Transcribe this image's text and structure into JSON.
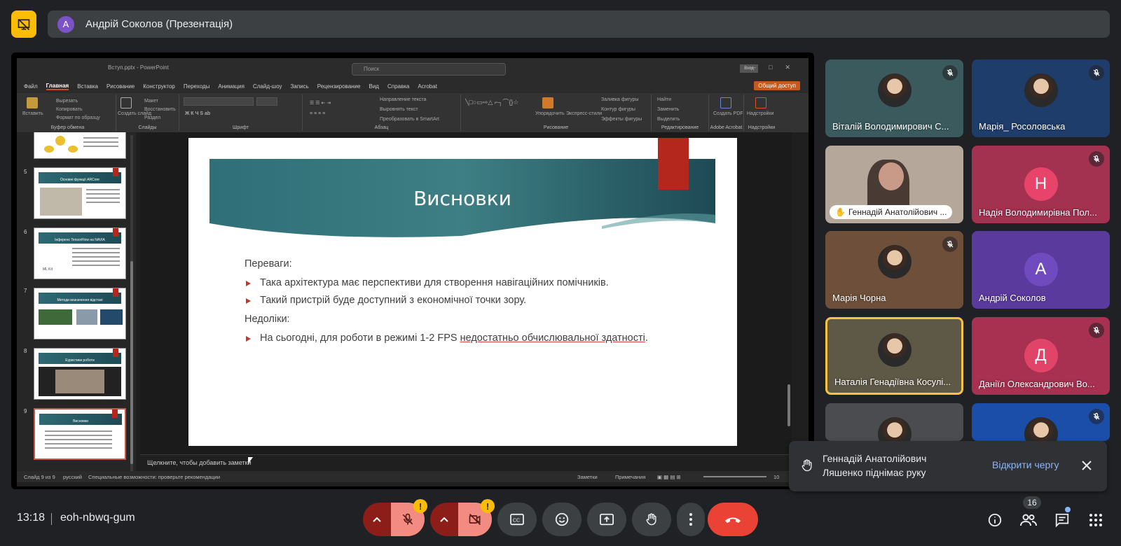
{
  "header": {
    "presenter_initial": "А",
    "presenter_title": "Андрій Соколов (Презентація)"
  },
  "powerpoint": {
    "file_name": "Вступ.pptx - PowerPoint",
    "search_placeholder": "Поиск",
    "account": "Вход",
    "share_label": "Общий доступ",
    "tabs": [
      "Файл",
      "Главная",
      "Вставка",
      "Рисование",
      "Конструктор",
      "Переходы",
      "Анимация",
      "Слайд-шоу",
      "Запись",
      "Рецензирование",
      "Вид",
      "Справка",
      "Acrobat"
    ],
    "ribbon_groups": {
      "clipboard": {
        "label": "Буфер обмена",
        "paste": "Вставить",
        "cut": "Вырезать",
        "copy": "Копировать",
        "format": "Формат по образцу"
      },
      "slides": {
        "label": "Слайды",
        "new_slide": "Создать слайд",
        "layout": "Макет",
        "reset": "Восстановить",
        "section": "Раздел"
      },
      "font": {
        "label": "Шрифт"
      },
      "paragraph": {
        "label": "Абзац",
        "text_dir": "Направление текста",
        "align_text": "Выровнять текст",
        "smartart": "Преобразовать в SmartArt"
      },
      "drawing": {
        "label": "Рисование",
        "arrange": "Упорядочить",
        "quick_styles": "Экспресс-стили",
        "fill": "Заливка фигуры",
        "outline": "Контур фигуры",
        "effects": "Эффекты фигуры"
      },
      "editing": {
        "label": "Редактирование",
        "find": "Найти",
        "replace": "Заменить",
        "select": "Выделить"
      },
      "acrobat": {
        "label": "Adobe Acrobat",
        "create_pdf": "Создать PDF"
      },
      "addins": {
        "label": "Надстройки",
        "addins": "Надстройки"
      }
    },
    "thumbnails": [
      {
        "num": "",
        "title": ""
      },
      {
        "num": "5",
        "title": "Основні функції ARCore"
      },
      {
        "num": "6",
        "title": "Інференс TensorFlow на NAVIA"
      },
      {
        "num": "7",
        "title": "Методи визначення відстані"
      },
      {
        "num": "8",
        "title": "Еуристики роботи"
      },
      {
        "num": "9",
        "title": "Висновки"
      }
    ],
    "thumb6_caption": "ML Kit",
    "slide": {
      "title": "Висновки",
      "pros_heading": "Переваги:",
      "pros": [
        "Така архітектура має перспективи для створення навігаційних помічників.",
        "Такий пристрій буде доступний з економічної точки зору."
      ],
      "cons_heading": "Недоліки:",
      "cons_pre": "На сьогодні, для роботи в режимі 1-2 FPS ",
      "cons_underlined": "недостатньо обчислювальної здатності",
      "cons_post": "."
    },
    "notes_placeholder": "Щелкните, чтобы добавить заметки",
    "status": {
      "slide_counter": "Слайд 9 из 9",
      "language": "русский",
      "accessibility": "Специальные возможности: проверьте рекомендации",
      "notes": "Заметки",
      "comments": "Примечания",
      "zoom": "10"
    }
  },
  "participants": [
    {
      "name": "Віталій Володимирович С...",
      "muted": true,
      "type": "photo",
      "bg": "#3a5a5e"
    },
    {
      "name": "Марія_ Росоловська",
      "muted": true,
      "type": "photo",
      "bg": "#1f3d6b"
    },
    {
      "name": "Геннадій Анатолійович ...",
      "muted": false,
      "type": "video",
      "bg": "#b5a89a",
      "hand_raised": true
    },
    {
      "name": "Надія Володимирівна Пол...",
      "muted": true,
      "type": "letter",
      "letter": "Н",
      "bg": "#a33150",
      "avatar": "#e8436a"
    },
    {
      "name": "Марія Чорна",
      "muted": true,
      "type": "photo",
      "bg": "#6e4f3a"
    },
    {
      "name": "Андрій Соколов",
      "muted": false,
      "type": "letter",
      "letter": "А",
      "bg": "#5b3a9e",
      "avatar": "#6f4bbf"
    },
    {
      "name": "Наталія Генадіївна Косулі...",
      "muted": false,
      "type": "photo",
      "bg": "#5e5846",
      "speaking": true
    },
    {
      "name": "Даніїл Олександрович Во...",
      "muted": true,
      "type": "letter",
      "letter": "Д",
      "bg": "#a83050",
      "avatar": "#e04468"
    },
    {
      "name": "",
      "muted": false,
      "type": "photo",
      "bg": "#4a4c50"
    },
    {
      "name": "",
      "muted": true,
      "type": "photo",
      "bg": "#1a4ea8"
    }
  ],
  "notification": {
    "message_line1": "Геннадій Анатолійович",
    "message_line2": "Ляшенко піднімає руку",
    "action": "Відкрити чергу"
  },
  "bottom_bar": {
    "time": "13:18",
    "meeting_code": "eoh-nbwq-gum",
    "participant_count": "16",
    "warning_mark": "!"
  },
  "colors": {
    "accent_blue": "#8ab4f8",
    "end_call": "#ea4335",
    "warning": "#fbbc04",
    "muted_red": "#f28b82"
  }
}
